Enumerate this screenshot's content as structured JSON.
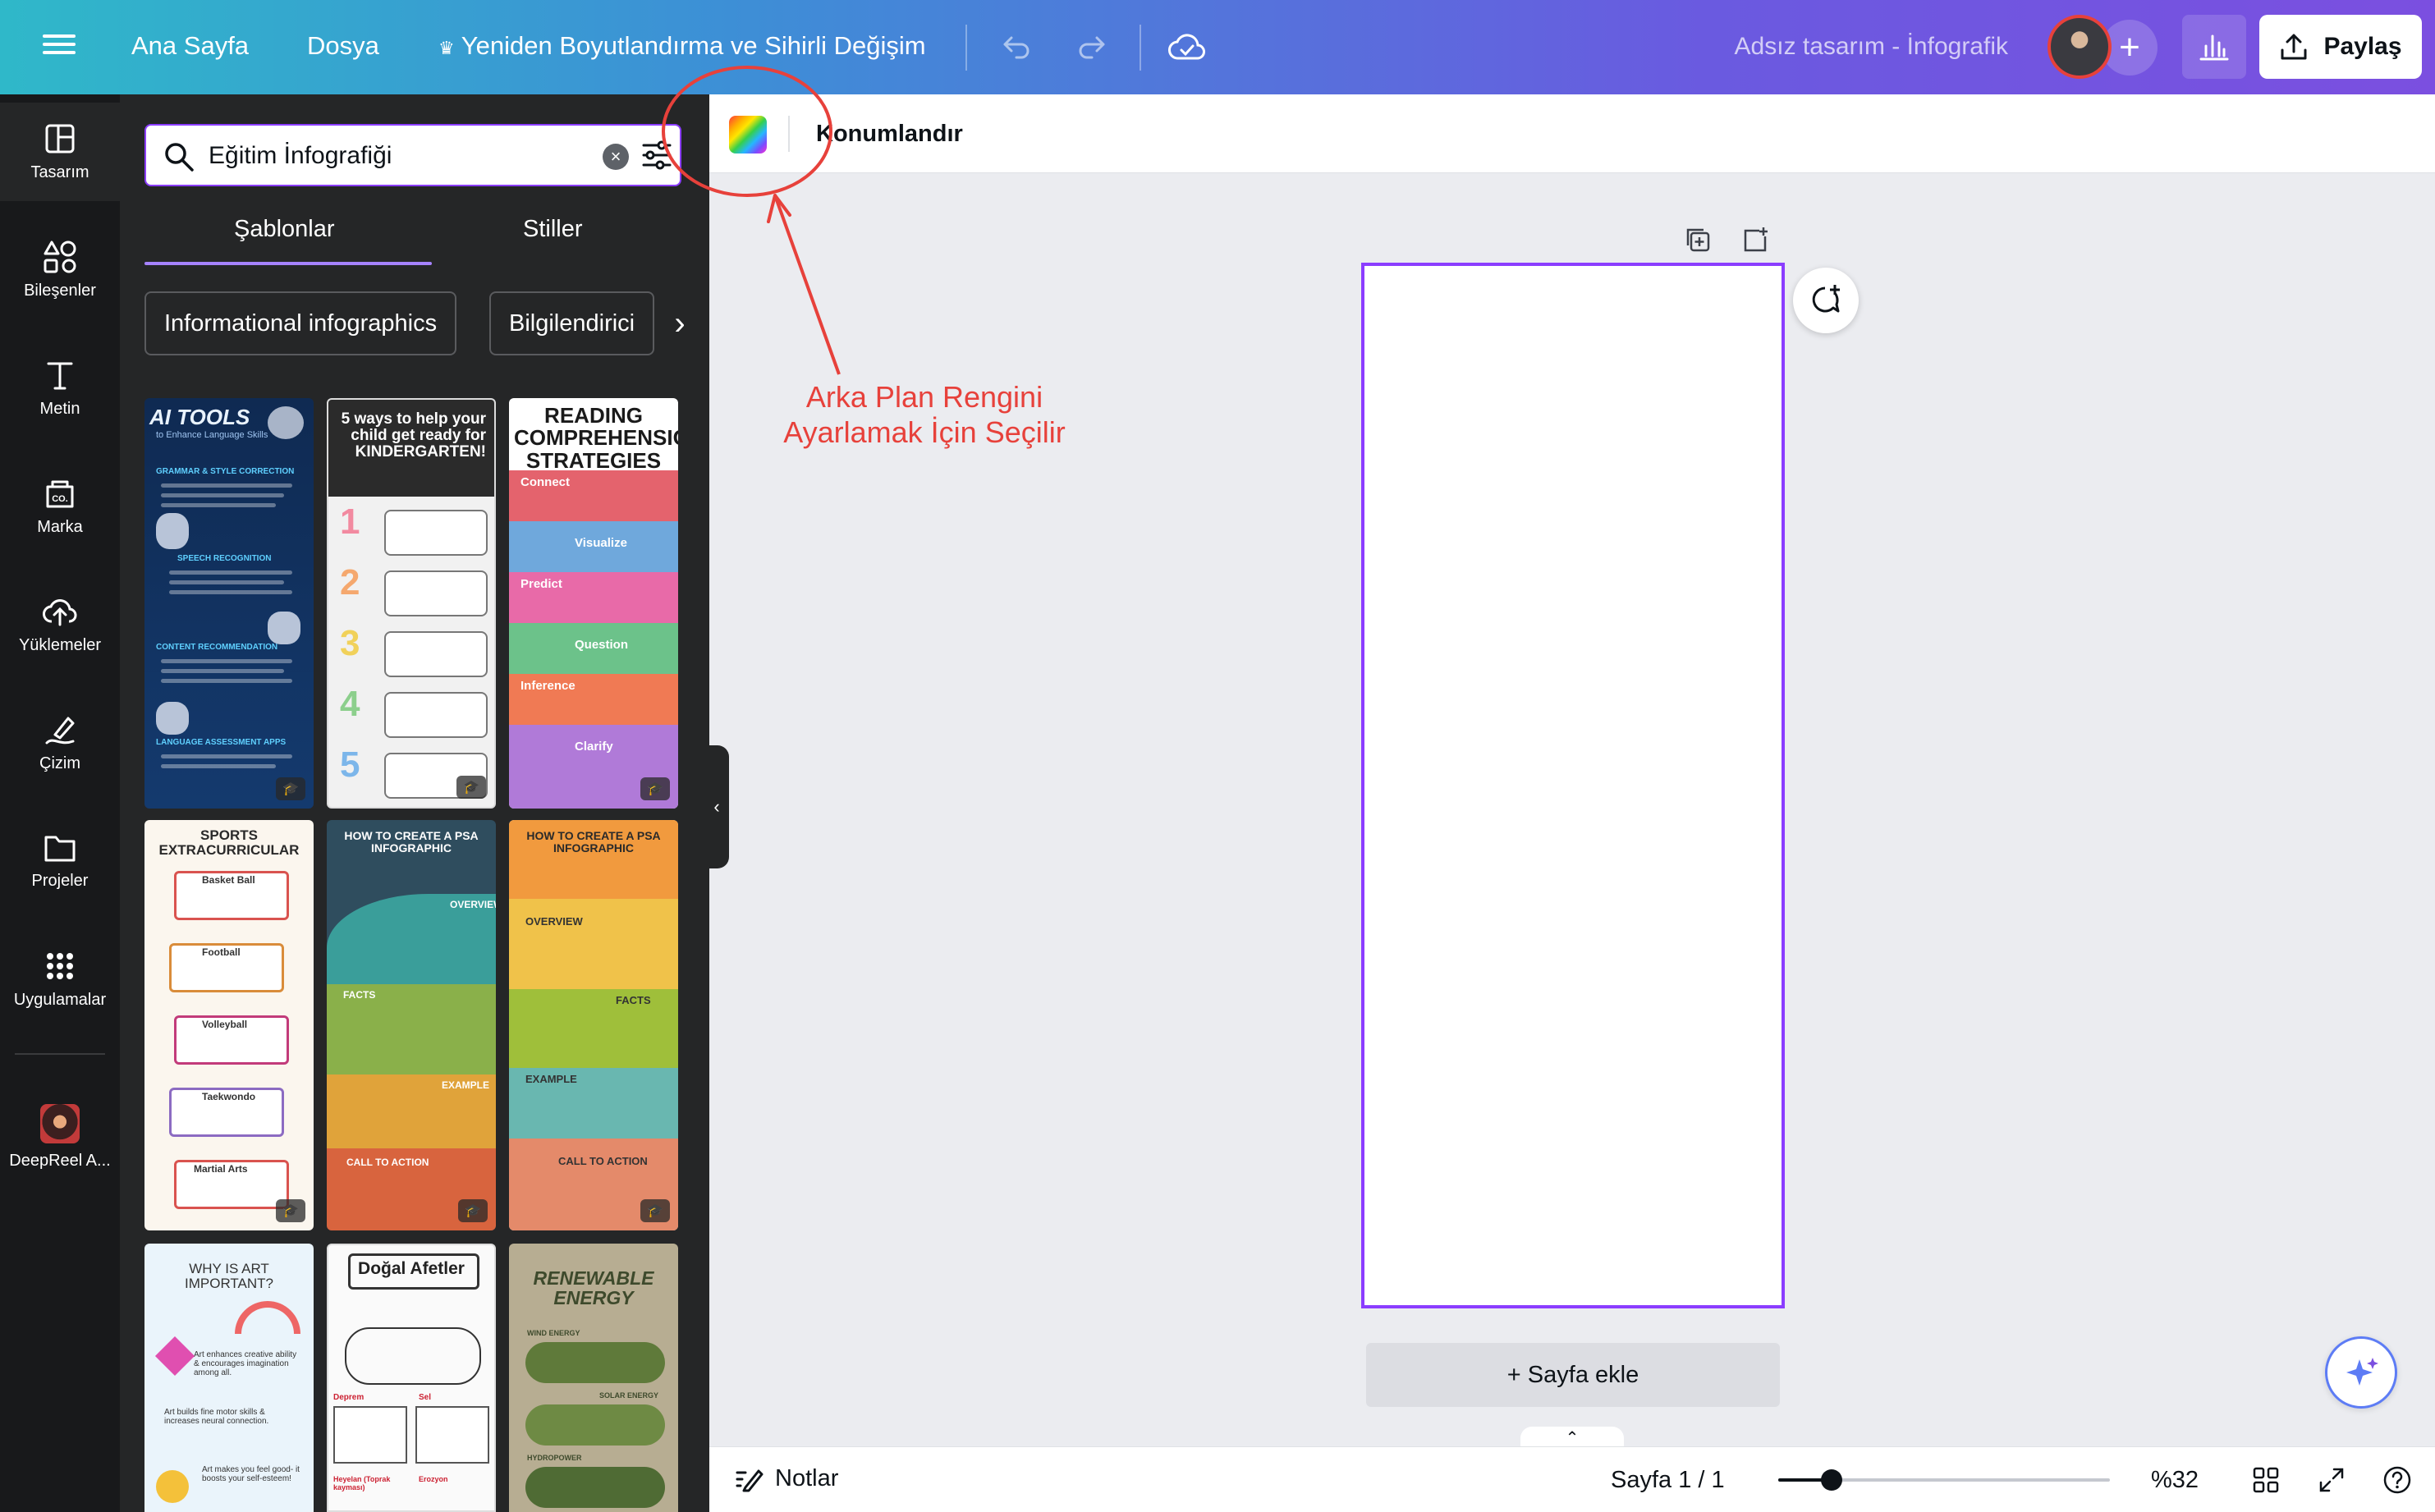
{
  "topbar": {
    "home": "Ana Sayfa",
    "file": "Dosya",
    "resize_crown_icon": "♛",
    "resize": "Yeniden Boyutlandırma ve Sihirli Değişim",
    "design_title": "Adsız tasarım - İnfografik",
    "share": "Paylaş"
  },
  "rail": {
    "items": [
      {
        "label": "Tasarım",
        "icon": "design-icon"
      },
      {
        "label": "Bileşenler",
        "icon": "elements-icon"
      },
      {
        "label": "Metin",
        "icon": "text-icon"
      },
      {
        "label": "Marka",
        "icon": "brand-icon"
      },
      {
        "label": "Yüklemeler",
        "icon": "upload-icon"
      },
      {
        "label": "Çizim",
        "icon": "draw-icon"
      },
      {
        "label": "Projeler",
        "icon": "folder-icon"
      },
      {
        "label": "Uygulamalar",
        "icon": "apps-icon"
      },
      {
        "label": "DeepReel A...",
        "icon": "deepreel-app-icon"
      }
    ],
    "brand_glyph": "CO."
  },
  "panel": {
    "search_value": "Eğitim İnfografiği",
    "tabs": [
      "Şablonlar",
      "Stiller"
    ],
    "chips": [
      "Informational infographics",
      "Bilgilendirici"
    ],
    "templates": [
      {
        "title": "AI TOOLS",
        "subtitle": "to Enhance Language Skills",
        "sections": [
          "GRAMMAR & STYLE CORRECTION",
          "SPEECH RECOGNITION",
          "CONTENT RECOMMENDATION",
          "LANGUAGE ASSESSMENT APPS"
        ]
      },
      {
        "title": "5 ways to help your child get ready for KINDERGARTEN!",
        "numbers": [
          "1",
          "2",
          "3",
          "4",
          "5"
        ]
      },
      {
        "title": "READING COMPREHENSION STRATEGIES",
        "sections": [
          "Connect",
          "Visualize",
          "Predict",
          "Question",
          "Inference",
          "Clarify"
        ]
      },
      {
        "title": "SPORTS EXTRACURRICULAR",
        "sections": [
          "Basket Ball",
          "Football",
          "Volleyball",
          "Taekwondo",
          "Martial Arts"
        ]
      },
      {
        "title": "HOW TO CREATE A PSA INFOGRAPHIC",
        "sections": [
          "OVERVIEW",
          "FACTS",
          "EXAMPLE",
          "CALL TO ACTION"
        ]
      },
      {
        "title": "HOW TO CREATE A PSA INFOGRAPHIC",
        "sections": [
          "OVERVIEW",
          "FACTS",
          "EXAMPLE",
          "CALL TO ACTION"
        ]
      },
      {
        "title": "WHY IS ART IMPORTANT?",
        "sections": [
          "Art enhances creative ability & encourages imagination among all.",
          "Art builds fine motor skills & increases neural connection.",
          "Art makes you feel good- it boosts your self-esteem!"
        ]
      },
      {
        "title": "Doğal Afetler",
        "sections": [
          "Deprem",
          "Sel",
          "Heyelan (Toprak kayması)",
          "Erozyon"
        ]
      },
      {
        "title": "RENEWABLE ENERGY",
        "sections": [
          "WIND ENERGY",
          "SOLAR ENERGY",
          "HYDROPOWER"
        ]
      }
    ]
  },
  "editor": {
    "position": "Konumlandır",
    "add_page": "+ Sayfa ekle"
  },
  "annotation": {
    "text": "Arka Plan Rengini Ayarlamak İçin Seçilir",
    "color": "#e7413b"
  },
  "bottombar": {
    "notes": "Notlar",
    "page_count": "Sayfa 1 / 1",
    "zoom": "%32",
    "zoom_value": 32
  },
  "colors": {
    "accent": "#8b3dff",
    "rail_bg": "#18191b",
    "panel_bg": "#252627"
  }
}
